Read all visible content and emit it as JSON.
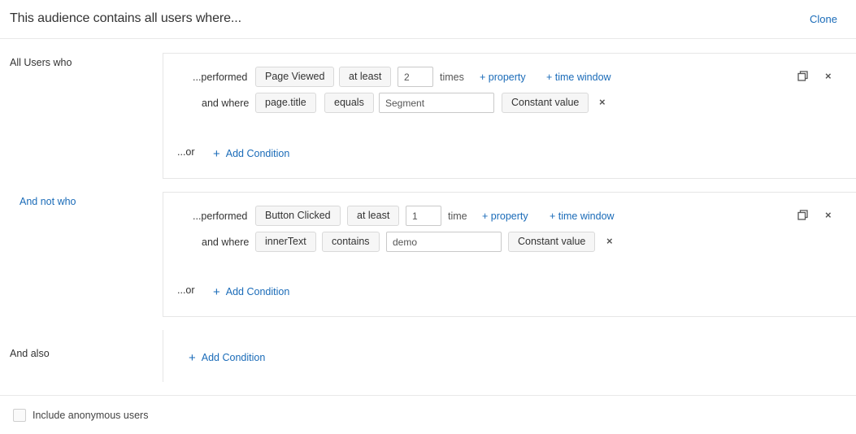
{
  "header": {
    "title": "This audience contains all users where...",
    "clone_label": "Clone"
  },
  "sections": {
    "all_users_label": "All Users who",
    "and_not_label": "And not who",
    "and_also_label": "And also"
  },
  "group1": {
    "performed_label": "...performed",
    "event": "Page Viewed",
    "operator": "at least",
    "count": "2",
    "unit": "times",
    "add_property": "+ property",
    "add_time_window": "+ time window",
    "where_label": "and where",
    "property": "page.title",
    "comparator": "equals",
    "value": "Segment",
    "value_type": "Constant value",
    "or_label": "...or",
    "add_condition": "Add Condition"
  },
  "group2": {
    "performed_label": "...performed",
    "event": "Button Clicked",
    "operator": "at least",
    "count": "1",
    "unit": "time",
    "add_property": "+ property",
    "add_time_window": "+ time window",
    "where_label": "and where",
    "property": "innerText",
    "comparator": "contains",
    "value": "demo",
    "value_type": "Constant value",
    "or_label": "...or",
    "add_condition": "Add Condition"
  },
  "also": {
    "add_condition": "Add Condition"
  },
  "footer": {
    "include_anonymous_label": "Include anonymous users",
    "include_anonymous_checked": false
  },
  "icons": {
    "remove": "×",
    "plus": "+"
  },
  "colors": {
    "link": "#1a6bb8",
    "border": "#e6e6e6",
    "pill_bg": "#f6f6f6"
  }
}
